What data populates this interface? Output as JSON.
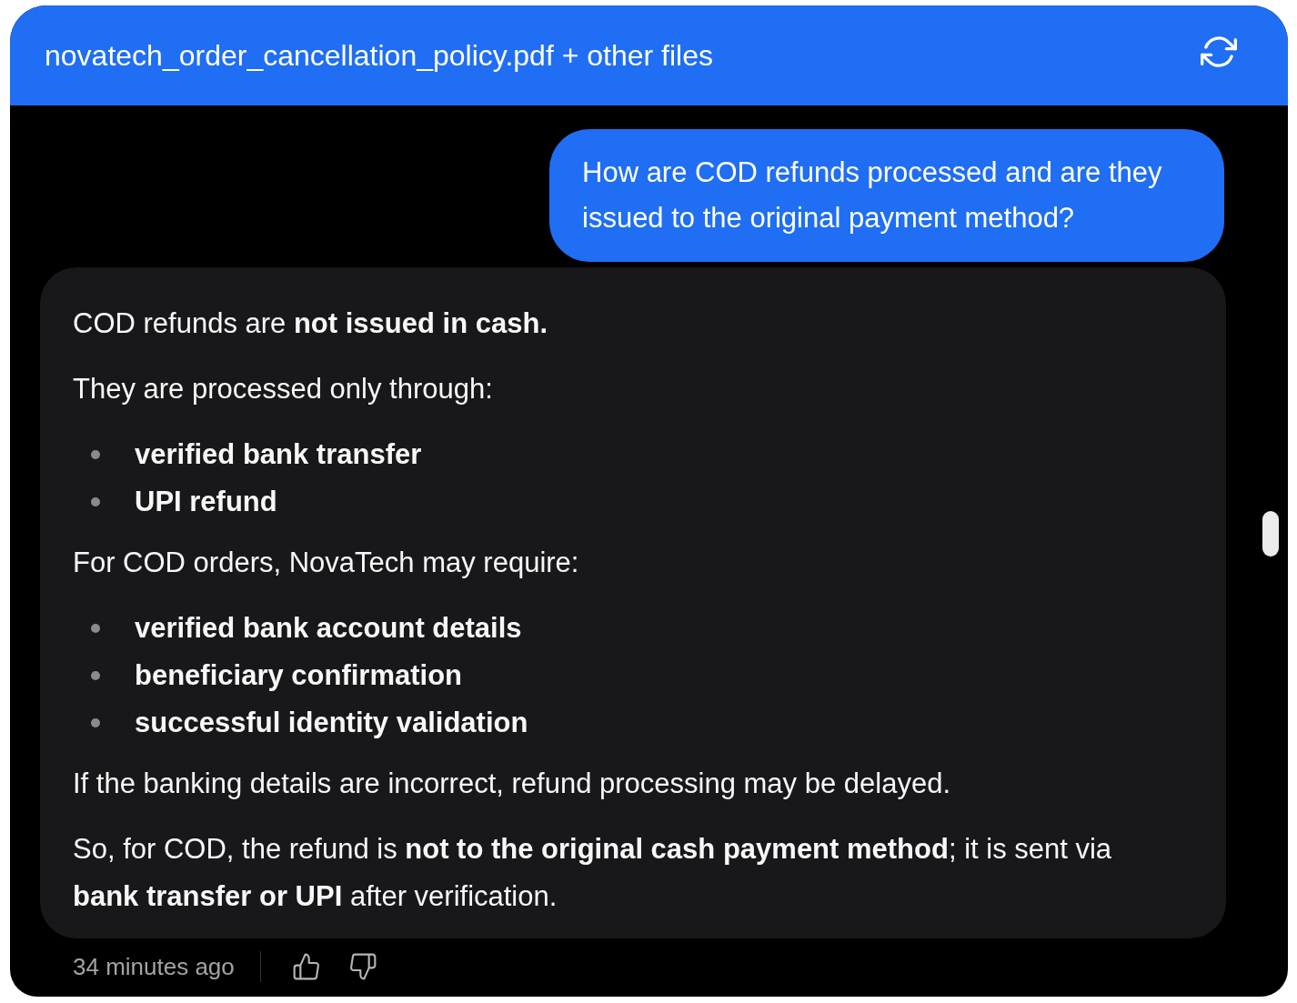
{
  "header": {
    "title": "novatech_order_cancellation_policy.pdf + other files"
  },
  "messages": [
    {
      "kind": "user",
      "text": "How are COD refunds processed and are they issued to the original payment method?"
    },
    {
      "kind": "assistant",
      "blocks": [
        {
          "kind": "paragraph",
          "text": "COD refunds are **not issued in cash.**"
        },
        {
          "kind": "paragraph",
          "text": "They are processed only through:"
        },
        {
          "kind": "list",
          "items": [
            "verified bank transfer",
            "UPI refund"
          ]
        },
        {
          "kind": "paragraph",
          "text": "For COD orders, NovaTech may require:"
        },
        {
          "kind": "list",
          "items": [
            "verified bank account details",
            "beneficiary confirmation",
            "successful identity validation"
          ]
        },
        {
          "kind": "paragraph",
          "text": "If the banking details are incorrect, refund processing may be delayed."
        },
        {
          "kind": "paragraph",
          "text": "So, for COD, the refund is **not to the original cash payment method**; it is sent via **bank transfer or UPI** after verification."
        }
      ]
    }
  ],
  "footer": {
    "time": "34 minutes ago"
  }
}
